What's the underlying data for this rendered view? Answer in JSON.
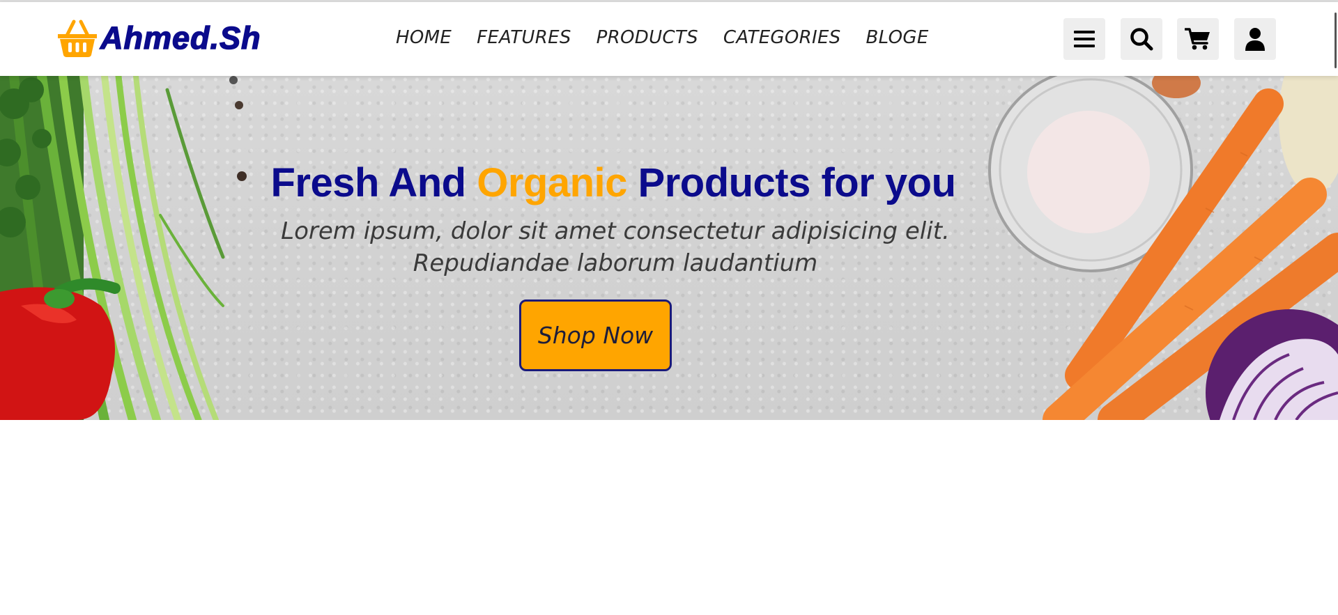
{
  "brand": {
    "name": "Ahmed.Sh",
    "icon": "shopping-basket-icon",
    "accent_color": "#ffa500",
    "primary_color": "#0b0b8c"
  },
  "nav": {
    "items": [
      {
        "label": "HOME"
      },
      {
        "label": "FEATURES"
      },
      {
        "label": "PRODUCTS"
      },
      {
        "label": "CATEGORIES"
      },
      {
        "label": "BLOGE"
      }
    ]
  },
  "header_icons": [
    {
      "name": "menu-bars-icon"
    },
    {
      "name": "search-icon"
    },
    {
      "name": "shopping-cart-icon"
    },
    {
      "name": "user-icon"
    }
  ],
  "hero": {
    "title_part1": "Fresh And ",
    "title_accent": "Organic",
    "title_part2": " Products for you",
    "subtitle_line1": "Lorem ipsum, dolor sit amet consectetur adipisicing elit.",
    "subtitle_line2": "Repudiandae laborum laudantium",
    "button_label": "Shop Now",
    "button_color": "#ffa500"
  }
}
